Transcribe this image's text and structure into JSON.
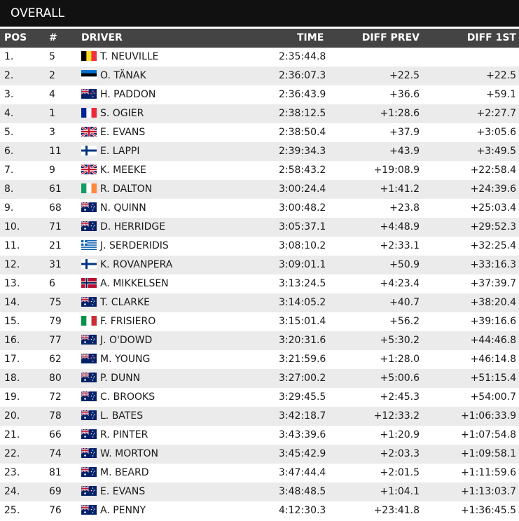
{
  "title": "OVERALL",
  "columns": {
    "pos": "POS",
    "num": "#",
    "driver": "DRIVER",
    "time": "TIME",
    "diff_prev": "DIFF PREV",
    "diff_first": "DIFF 1ST"
  },
  "rows": [
    {
      "pos": "1.",
      "num": "5",
      "flag": "belgium-flag",
      "driver": "T. NEUVILLE",
      "time": "2:35:44.8",
      "diff_prev": "",
      "diff_first": ""
    },
    {
      "pos": "2.",
      "num": "2",
      "flag": "estonia-flag",
      "driver": "O. TÄNAK",
      "time": "2:36:07.3",
      "diff_prev": "+22.5",
      "diff_first": "+22.5"
    },
    {
      "pos": "3.",
      "num": "4",
      "flag": "new-zealand-flag",
      "driver": "H. PADDON",
      "time": "2:36:43.9",
      "diff_prev": "+36.6",
      "diff_first": "+59.1"
    },
    {
      "pos": "4.",
      "num": "1",
      "flag": "france-flag",
      "driver": "S. OGIER",
      "time": "2:38:12.5",
      "diff_prev": "+1:28.6",
      "diff_first": "+2:27.7"
    },
    {
      "pos": "5.",
      "num": "3",
      "flag": "uk-flag",
      "driver": "E. EVANS",
      "time": "2:38:50.4",
      "diff_prev": "+37.9",
      "diff_first": "+3:05.6"
    },
    {
      "pos": "6.",
      "num": "11",
      "flag": "finland-flag",
      "driver": "E. LAPPI",
      "time": "2:39:34.3",
      "diff_prev": "+43.9",
      "diff_first": "+3:49.5"
    },
    {
      "pos": "7.",
      "num": "9",
      "flag": "uk-flag",
      "driver": "K. MEEKE",
      "time": "2:58:43.2",
      "diff_prev": "+19:08.9",
      "diff_first": "+22:58.4"
    },
    {
      "pos": "8.",
      "num": "61",
      "flag": "ireland-flag",
      "driver": "R. DALTON",
      "time": "3:00:24.4",
      "diff_prev": "+1:41.2",
      "diff_first": "+24:39.6"
    },
    {
      "pos": "9.",
      "num": "68",
      "flag": "australia-flag",
      "driver": "N. QUINN",
      "time": "3:00:48.2",
      "diff_prev": "+23.8",
      "diff_first": "+25:03.4"
    },
    {
      "pos": "10.",
      "num": "71",
      "flag": "australia-flag",
      "driver": "D. HERRIDGE",
      "time": "3:05:37.1",
      "diff_prev": "+4:48.9",
      "diff_first": "+29:52.3"
    },
    {
      "pos": "11.",
      "num": "21",
      "flag": "greece-flag",
      "driver": "J. SERDERIDIS",
      "time": "3:08:10.2",
      "diff_prev": "+2:33.1",
      "diff_first": "+32:25.4"
    },
    {
      "pos": "12.",
      "num": "31",
      "flag": "finland-flag",
      "driver": "K. ROVANPERA",
      "time": "3:09:01.1",
      "diff_prev": "+50.9",
      "diff_first": "+33:16.3"
    },
    {
      "pos": "13.",
      "num": "6",
      "flag": "norway-flag",
      "driver": "A. MIKKELSEN",
      "time": "3:13:24.5",
      "diff_prev": "+4:23.4",
      "diff_first": "+37:39.7"
    },
    {
      "pos": "14.",
      "num": "75",
      "flag": "australia-flag",
      "driver": "T. CLARKE",
      "time": "3:14:05.2",
      "diff_prev": "+40.7",
      "diff_first": "+38:20.4"
    },
    {
      "pos": "15.",
      "num": "79",
      "flag": "italy-flag",
      "driver": "F. FRISIERO",
      "time": "3:15:01.4",
      "diff_prev": "+56.2",
      "diff_first": "+39:16.6"
    },
    {
      "pos": "16.",
      "num": "77",
      "flag": "australia-flag",
      "driver": "J. O'DOWD",
      "time": "3:20:31.6",
      "diff_prev": "+5:30.2",
      "diff_first": "+44:46.8"
    },
    {
      "pos": "17.",
      "num": "62",
      "flag": "new-zealand-flag",
      "driver": "M. YOUNG",
      "time": "3:21:59.6",
      "diff_prev": "+1:28.0",
      "diff_first": "+46:14.8"
    },
    {
      "pos": "18.",
      "num": "80",
      "flag": "australia-flag",
      "driver": "P. DUNN",
      "time": "3:27:00.2",
      "diff_prev": "+5:00.6",
      "diff_first": "+51:15.4"
    },
    {
      "pos": "19.",
      "num": "72",
      "flag": "australia-flag",
      "driver": "C. BROOKS",
      "time": "3:29:45.5",
      "diff_prev": "+2:45.3",
      "diff_first": "+54:00.7"
    },
    {
      "pos": "20.",
      "num": "78",
      "flag": "australia-flag",
      "driver": "L. BATES",
      "time": "3:42:18.7",
      "diff_prev": "+12:33.2",
      "diff_first": "+1:06:33.9"
    },
    {
      "pos": "21.",
      "num": "66",
      "flag": "australia-flag",
      "driver": "R. PINTER",
      "time": "3:43:39.6",
      "diff_prev": "+1:20.9",
      "diff_first": "+1:07:54.8"
    },
    {
      "pos": "22.",
      "num": "74",
      "flag": "australia-flag",
      "driver": "W. MORTON",
      "time": "3:45:42.9",
      "diff_prev": "+2:03.3",
      "diff_first": "+1:09:58.1"
    },
    {
      "pos": "23.",
      "num": "81",
      "flag": "australia-flag",
      "driver": "M. BEARD",
      "time": "3:47:44.4",
      "diff_prev": "+2:01.5",
      "diff_first": "+1:11:59.6"
    },
    {
      "pos": "24.",
      "num": "69",
      "flag": "australia-flag",
      "driver": "E. EVANS",
      "time": "3:48:48.5",
      "diff_prev": "+1:04.1",
      "diff_first": "+1:13:03.7"
    },
    {
      "pos": "25.",
      "num": "76",
      "flag": "australia-flag",
      "driver": "A. PENNY",
      "time": "4:12:30.3",
      "diff_prev": "+23:41.8",
      "diff_first": "+1:36:45.5"
    }
  ]
}
